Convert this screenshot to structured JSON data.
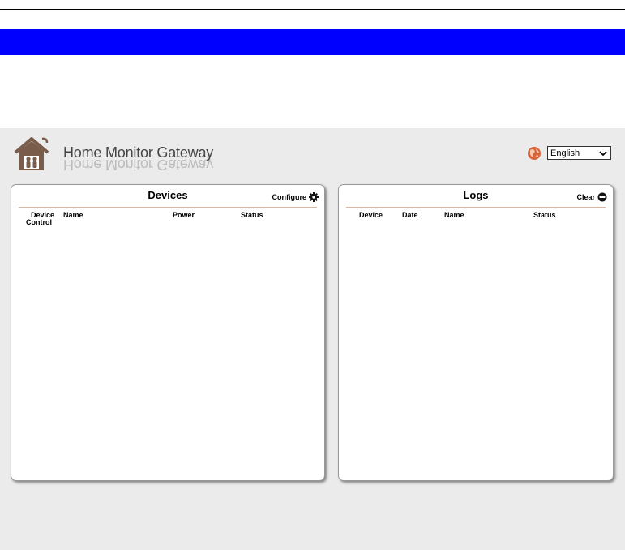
{
  "app": {
    "title": "Home Monitor Gateway"
  },
  "language": {
    "selected": "English"
  },
  "devices_panel": {
    "title": "Devices",
    "action_label": "Configure",
    "columns": {
      "device_control_line1": "Device",
      "device_control_line2": "Control",
      "name": "Name",
      "power": "Power",
      "status": "Status"
    }
  },
  "logs_panel": {
    "title": "Logs",
    "action_label": "Clear",
    "columns": {
      "device": "Device",
      "date": "Date",
      "name": "Name",
      "status": "Status"
    }
  },
  "colors": {
    "brand_brown": "#7a5c4b",
    "banner_blue": "#0000ff",
    "app_background": "#ebebeb",
    "divider": "#d9b7a2"
  },
  "icons": {
    "logo": "house-icon",
    "globe": "globe-icon",
    "configure": "gear-icon",
    "clear": "minus-circle-icon",
    "dropdown": "chevron-down-icon"
  }
}
